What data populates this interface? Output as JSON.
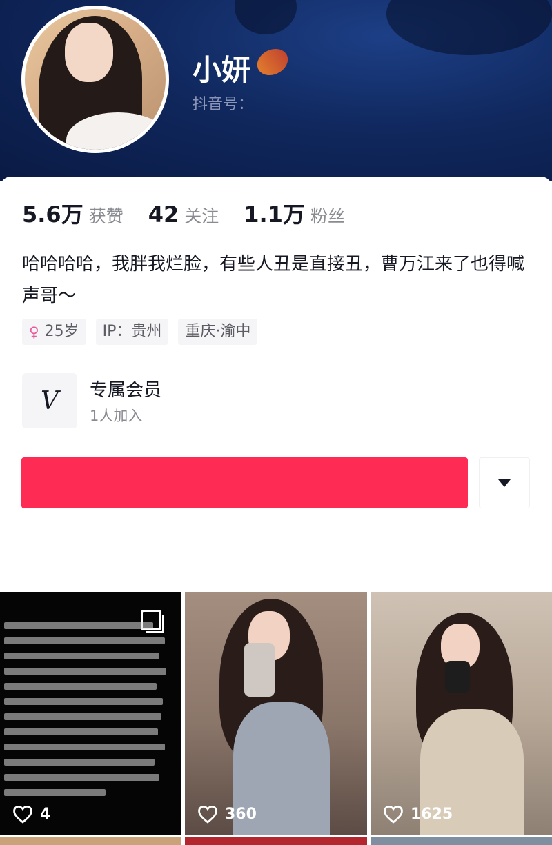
{
  "profile": {
    "name": "小妍",
    "douyin_id_label": "抖音号："
  },
  "stats": [
    {
      "value": "5.6万",
      "label": "获赞"
    },
    {
      "value": "42",
      "label": "关注"
    },
    {
      "value": "1.1万",
      "label": "粉丝"
    }
  ],
  "bio": "哈哈哈哈，我胖我烂脸，有些人丑是直接丑，曹万江来了也得喊声哥～",
  "tags": {
    "age": "25岁",
    "ip": "IP：贵州",
    "location": "重庆·渝中"
  },
  "member": {
    "logo_text": "V",
    "title": "专属会员",
    "subtitle": "1人加入"
  },
  "colors": {
    "accent": "#fe2c55",
    "banner": "#10285e"
  },
  "posts": [
    {
      "likes": "4",
      "type": "text-image"
    },
    {
      "likes": "360",
      "type": "photo"
    },
    {
      "likes": "1625",
      "type": "photo"
    }
  ]
}
